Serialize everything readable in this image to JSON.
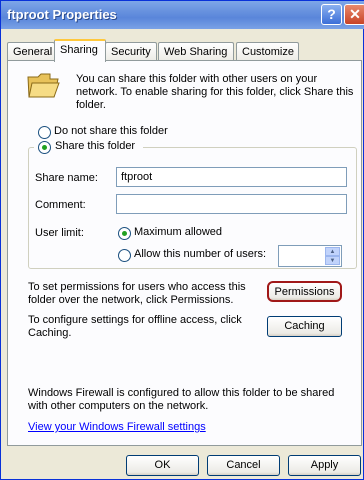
{
  "window": {
    "title": "ftproot Properties",
    "help_glyph": "?",
    "close_glyph": "✕"
  },
  "tabs": [
    {
      "label": "General"
    },
    {
      "label": "Sharing"
    },
    {
      "label": "Security"
    },
    {
      "label": "Web Sharing"
    },
    {
      "label": "Customize"
    }
  ],
  "sharing": {
    "intro_line1": "You can share this folder with other users on your",
    "intro_line2": "network.  To enable sharing for this folder, click Share this",
    "intro_line3": "folder.",
    "do_not_share_label": "Do not share this folder",
    "share_label": "Share this folder",
    "share_name_label": "Share name:",
    "share_name_value": "ftproot",
    "comment_label": "Comment:",
    "comment_value": "",
    "user_limit_label": "User limit:",
    "maximum_allowed_label": "Maximum allowed",
    "allow_number_label": "Allow this number of users:",
    "user_count_value": "",
    "permissions_text_line1": "To set permissions for users who access this",
    "permissions_text_line2": "folder over the network, click Permissions.",
    "permissions_button": "Permissions",
    "caching_text_line1": "To configure settings for offline access, click",
    "caching_text_line2": "Caching.",
    "caching_button": "Caching"
  },
  "firewall": {
    "text_line1": "Windows Firewall is configured to allow this folder to be shared",
    "text_line2": "with other computers on the network.",
    "link": "View your Windows Firewall settings"
  },
  "buttons": {
    "ok": "OK",
    "cancel": "Cancel",
    "apply": "Apply"
  },
  "colors": {
    "title_bar": "#5a86da",
    "tab_highlight": "#ffc83c",
    "link": "#0000ff",
    "focus_ring": "#a01818"
  }
}
